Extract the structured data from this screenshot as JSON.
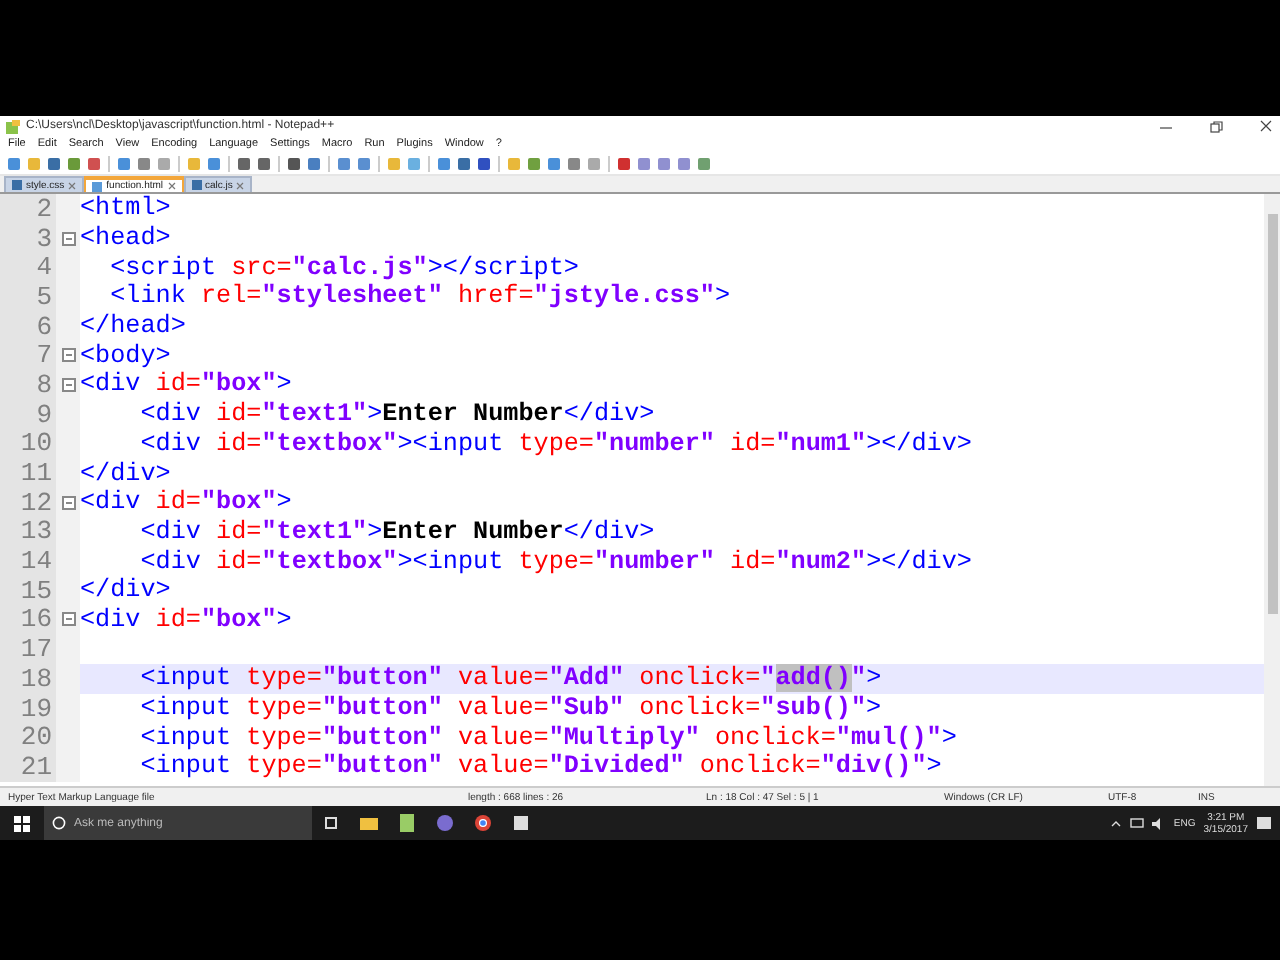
{
  "window": {
    "title": "C:\\Users\\ncl\\Desktop\\javascript\\function.html - Notepad++"
  },
  "menu": [
    "File",
    "Edit",
    "Search",
    "View",
    "Encoding",
    "Language",
    "Settings",
    "Macro",
    "Run",
    "Plugins",
    "Window",
    "?"
  ],
  "tabs": [
    {
      "label": "style.css",
      "selected": false
    },
    {
      "label": "function.html",
      "selected": true
    },
    {
      "label": "calc.js",
      "selected": false
    }
  ],
  "editor": {
    "lines": [
      {
        "number": "2",
        "fold": false,
        "current": false,
        "tokens": [
          {
            "kind": "tag",
            "text": "<html>"
          }
        ]
      },
      {
        "number": "3",
        "fold": true,
        "current": false,
        "tokens": [
          {
            "kind": "tag",
            "text": "<head>"
          }
        ]
      },
      {
        "number": "4",
        "fold": false,
        "current": false,
        "tokens": [
          {
            "kind": "tag",
            "text": "  <script"
          },
          {
            "kind": "attr",
            "text": " src="
          },
          {
            "kind": "value",
            "text": "\"calc.js\""
          },
          {
            "kind": "tag",
            "text": "></script>"
          }
        ]
      },
      {
        "number": "5",
        "fold": false,
        "current": false,
        "tokens": [
          {
            "kind": "tag",
            "text": "  <link"
          },
          {
            "kind": "attr",
            "text": " rel="
          },
          {
            "kind": "value",
            "text": "\"stylesheet\""
          },
          {
            "kind": "attr",
            "text": " href="
          },
          {
            "kind": "value",
            "text": "\"jstyle.css\""
          },
          {
            "kind": "tag",
            "text": ">"
          }
        ]
      },
      {
        "number": "6",
        "fold": false,
        "current": false,
        "tokens": [
          {
            "kind": "tag",
            "text": "</head>"
          }
        ]
      },
      {
        "number": "7",
        "fold": true,
        "current": false,
        "tokens": [
          {
            "kind": "tag",
            "text": "<body>"
          }
        ]
      },
      {
        "number": "8",
        "fold": true,
        "current": false,
        "tokens": [
          {
            "kind": "tag",
            "text": "<div"
          },
          {
            "kind": "attr",
            "text": " id="
          },
          {
            "kind": "value",
            "text": "\"box\""
          },
          {
            "kind": "tag",
            "text": ">"
          }
        ]
      },
      {
        "number": "9",
        "fold": false,
        "current": false,
        "tokens": [
          {
            "kind": "tag",
            "text": "    <div"
          },
          {
            "kind": "attr",
            "text": " id="
          },
          {
            "kind": "value",
            "text": "\"text1\""
          },
          {
            "kind": "tag",
            "text": ">"
          },
          {
            "kind": "text",
            "text": "Enter Number"
          },
          {
            "kind": "tag",
            "text": "</div>"
          }
        ]
      },
      {
        "number": "10",
        "fold": false,
        "current": false,
        "tokens": [
          {
            "kind": "tag",
            "text": "    <div"
          },
          {
            "kind": "attr",
            "text": " id="
          },
          {
            "kind": "value",
            "text": "\"textbox\""
          },
          {
            "kind": "tag",
            "text": "><input"
          },
          {
            "kind": "attr",
            "text": " type="
          },
          {
            "kind": "value",
            "text": "\"number\""
          },
          {
            "kind": "attr",
            "text": " id="
          },
          {
            "kind": "value",
            "text": "\"num1\""
          },
          {
            "kind": "tag",
            "text": "></div>"
          }
        ]
      },
      {
        "number": "11",
        "fold": false,
        "current": false,
        "tokens": [
          {
            "kind": "tag",
            "text": "</div>"
          }
        ]
      },
      {
        "number": "12",
        "fold": true,
        "current": false,
        "tokens": [
          {
            "kind": "tag",
            "text": "<div"
          },
          {
            "kind": "attr",
            "text": " id="
          },
          {
            "kind": "value",
            "text": "\"box\""
          },
          {
            "kind": "tag",
            "text": ">"
          }
        ]
      },
      {
        "number": "13",
        "fold": false,
        "current": false,
        "tokens": [
          {
            "kind": "tag",
            "text": "    <div"
          },
          {
            "kind": "attr",
            "text": " id="
          },
          {
            "kind": "value",
            "text": "\"text1\""
          },
          {
            "kind": "tag",
            "text": ">"
          },
          {
            "kind": "text",
            "text": "Enter Number"
          },
          {
            "kind": "tag",
            "text": "</div>"
          }
        ]
      },
      {
        "number": "14",
        "fold": false,
        "current": false,
        "tokens": [
          {
            "kind": "tag",
            "text": "    <div"
          },
          {
            "kind": "attr",
            "text": " id="
          },
          {
            "kind": "value",
            "text": "\"textbox\""
          },
          {
            "kind": "tag",
            "text": "><input"
          },
          {
            "kind": "attr",
            "text": " type="
          },
          {
            "kind": "value",
            "text": "\"number\""
          },
          {
            "kind": "attr",
            "text": " id="
          },
          {
            "kind": "value",
            "text": "\"num2\""
          },
          {
            "kind": "tag",
            "text": "></div>"
          }
        ]
      },
      {
        "number": "15",
        "fold": false,
        "current": false,
        "tokens": [
          {
            "kind": "tag",
            "text": "</div>"
          }
        ]
      },
      {
        "number": "16",
        "fold": true,
        "current": false,
        "tokens": [
          {
            "kind": "tag",
            "text": "<div"
          },
          {
            "kind": "attr",
            "text": " id="
          },
          {
            "kind": "value",
            "text": "\"box\""
          },
          {
            "kind": "tag",
            "text": ">"
          }
        ]
      },
      {
        "number": "17",
        "fold": false,
        "current": false
      },
      {
        "number": "18",
        "fold": false,
        "current": true,
        "tokens": [
          {
            "kind": "tag",
            "text": "    <input"
          },
          {
            "kind": "attr",
            "text": " type="
          },
          {
            "kind": "value",
            "text": "\"button\""
          },
          {
            "kind": "attr",
            "text": " value="
          },
          {
            "kind": "value",
            "text": "\"Add\""
          },
          {
            "kind": "attr",
            "text": " onclick="
          },
          {
            "kind": "value",
            "text": "\""
          },
          {
            "kind": "match",
            "text": "add()"
          },
          {
            "kind": "value",
            "text": "\""
          },
          {
            "kind": "tag",
            "text": ">"
          }
        ]
      },
      {
        "number": "19",
        "fold": false,
        "current": false,
        "tokens": [
          {
            "kind": "tag",
            "text": "    <input"
          },
          {
            "kind": "attr",
            "text": " type="
          },
          {
            "kind": "value",
            "text": "\"button\""
          },
          {
            "kind": "attr",
            "text": " value="
          },
          {
            "kind": "value",
            "text": "\"Sub\""
          },
          {
            "kind": "attr",
            "text": " onclick="
          },
          {
            "kind": "value",
            "text": "\"sub()\""
          },
          {
            "kind": "tag",
            "text": ">"
          }
        ]
      },
      {
        "number": "20",
        "fold": false,
        "current": false,
        "tokens": [
          {
            "kind": "tag",
            "text": "    <input"
          },
          {
            "kind": "attr",
            "text": " type="
          },
          {
            "kind": "value",
            "text": "\"button\""
          },
          {
            "kind": "attr",
            "text": " value="
          },
          {
            "kind": "value",
            "text": "\"Multiply\""
          },
          {
            "kind": "attr",
            "text": " onclick="
          },
          {
            "kind": "value",
            "text": "\"mul()\""
          },
          {
            "kind": "tag",
            "text": ">"
          }
        ]
      },
      {
        "number": "21",
        "fold": false,
        "current": false,
        "tokens": [
          {
            "kind": "tag",
            "text": "    <input"
          },
          {
            "kind": "attr",
            "text": " type="
          },
          {
            "kind": "value",
            "text": "\"button\""
          },
          {
            "kind": "attr",
            "text": " value="
          },
          {
            "kind": "value",
            "text": "\"Divided\""
          },
          {
            "kind": "attr",
            "text": " onclick="
          },
          {
            "kind": "value",
            "text": "\"div()\""
          },
          {
            "kind": "tag",
            "text": ">"
          }
        ]
      }
    ]
  },
  "status_bar": [
    "Hyper Text Markup Language file",
    "length : 668    lines : 26",
    "Ln : 18    Col : 47    Sel : 5 | 1",
    "Windows (CR LF)",
    "UTF-8",
    "INS"
  ],
  "taskbar": {
    "search": {
      "placeholder": "Ask me anything"
    },
    "language": "ENG",
    "time": "3:21 PM",
    "date": "3/15/2017"
  }
}
